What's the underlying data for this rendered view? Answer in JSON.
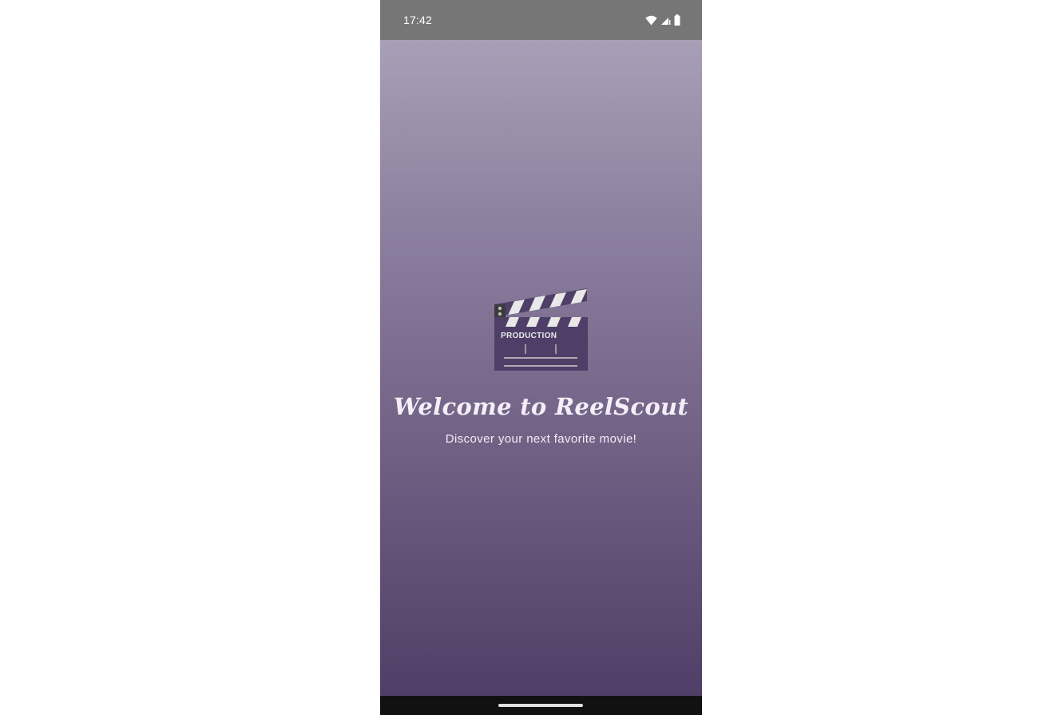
{
  "status_bar": {
    "time": "17:42",
    "icons": [
      "wifi-icon",
      "cellular-signal-icon",
      "battery-icon"
    ]
  },
  "splash": {
    "logo_label": "PRODUCTION",
    "logo_icon": "clapperboard-icon",
    "title": "Welcome to ReelScout",
    "subtitle": "Discover your next favorite movie!"
  },
  "colors": {
    "status_bar": "#767676",
    "gradient_top": "#a89fb7",
    "gradient_bottom": "#4f3f68",
    "clapper_body": "#4f3f68",
    "text": "#f4eef8",
    "nav_bar": "#111111"
  }
}
